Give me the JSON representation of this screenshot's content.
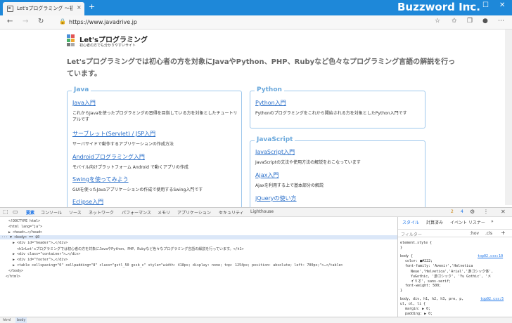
{
  "browser": {
    "tab_title": "Let'sプログラミング ～初心者の方も分",
    "brand": "Buzzword Inc.",
    "url": "https://www.javadrive.jp",
    "new_tab": "+",
    "tab_close": "×"
  },
  "site": {
    "logo_name": "Let'sプログラミング",
    "logo_tagline": "初心者の方でも分かりやすいサイト",
    "intro": "Let'sプログラミングでは初心者の方を対象にJavaやPython、PHP、Rubyなど色々なプログラミング言語の解説を行っています。"
  },
  "boxes": {
    "java": {
      "title": "Java",
      "items": [
        {
          "link": "Java入門",
          "desc": "これからJavaを使ったプログラミングの習得を目指している方を対象としたチュートリアルです"
        },
        {
          "link": "サーブレット(Servlet) / JSP入門",
          "desc": "サーバサイドで動作するアプリケーションの作成方法"
        },
        {
          "link": "Androidプログラミング入門",
          "desc": "モバイル向けプラットフォーム Android で動くアプリの作成"
        },
        {
          "link": "Swingを使ってみよう",
          "desc": "GUIを使ったJavaアプリケーションの作成で使用するSwing入門です"
        },
        {
          "link": "Eclipse入門",
          "desc": ""
        }
      ]
    },
    "python": {
      "title": "Python",
      "items": [
        {
          "link": "Python入門",
          "desc": "Pythonのプログラミングをこれから開始される方を対象としたPython入門です"
        }
      ]
    },
    "javascript": {
      "title": "JavaScript",
      "items": [
        {
          "link": "JavaScript入門",
          "desc": "JavaScriptの文法や使用方法の解説をおこなっています"
        },
        {
          "link": "Ajax入門",
          "desc": "Ajaxを利用する上で基本部分の解説"
        },
        {
          "link": "jQueryの使い方",
          "desc": ""
        }
      ]
    }
  },
  "devtools": {
    "tabs": [
      "要素",
      "コンソール",
      "ソース",
      "ネットワーク",
      "パフォーマンス",
      "メモリ",
      "アプリケーション",
      "セキュリティ",
      "Lighthouse"
    ],
    "more": "»",
    "warn_count": "2",
    "info_count": "4",
    "elements": [
      "<!DOCTYPE html>",
      "<html lang=\"ja\">",
      "▶ <head>…</head>",
      "··· ▼ <body> == $0",
      "▶ <div id=\"header\">…</div>",
      "<h1>Let'sプログラミングでは初心者の方を対象にJavaやPython、PHP、Rubyなど色々なプログラミング言語の解説を行っています。</h1>",
      "▶ <div class=\"container\">…</div>",
      "▶ <div id=\"footer\">…</div>",
      "▶ <table cellspacing=\"0\" cellpadding=\"8\" class=\"gstl_50 gssb_c\" style=\"width: 418px; display: none; top: 1254px; position: absolute; left: 700px;\">…</table>",
      "</body>",
      "</html>"
    ],
    "side_tabs": [
      "スタイル",
      "計算済み",
      "イベント リスナー",
      "»"
    ],
    "filter": "フィルター",
    "hov": ":hov",
    ".cls": ".cls",
    "add": "+",
    "styles": [
      "element.style {",
      "}",
      "body {",
      "color: ■#222;",
      "font-family: 'Avenir','Helvetica",
      "Neue','Helvetica','Arial','游ゴシック体',",
      "YuGothic, '游ゴシック', 'Yu Gothic', 'メ",
      "イリオ', sans-serif;",
      "font-weight: 500;",
      "}",
      "body, div, h1, h2, h3, pre, p,",
      "ul, ol, li {",
      "margin: ▶ 0;",
      "padding: ▶ 0;",
      "}"
    ],
    "src1": "top02.css:10",
    "src2": "top02.css:5",
    "breadcrumb": [
      "html",
      "body"
    ]
  }
}
